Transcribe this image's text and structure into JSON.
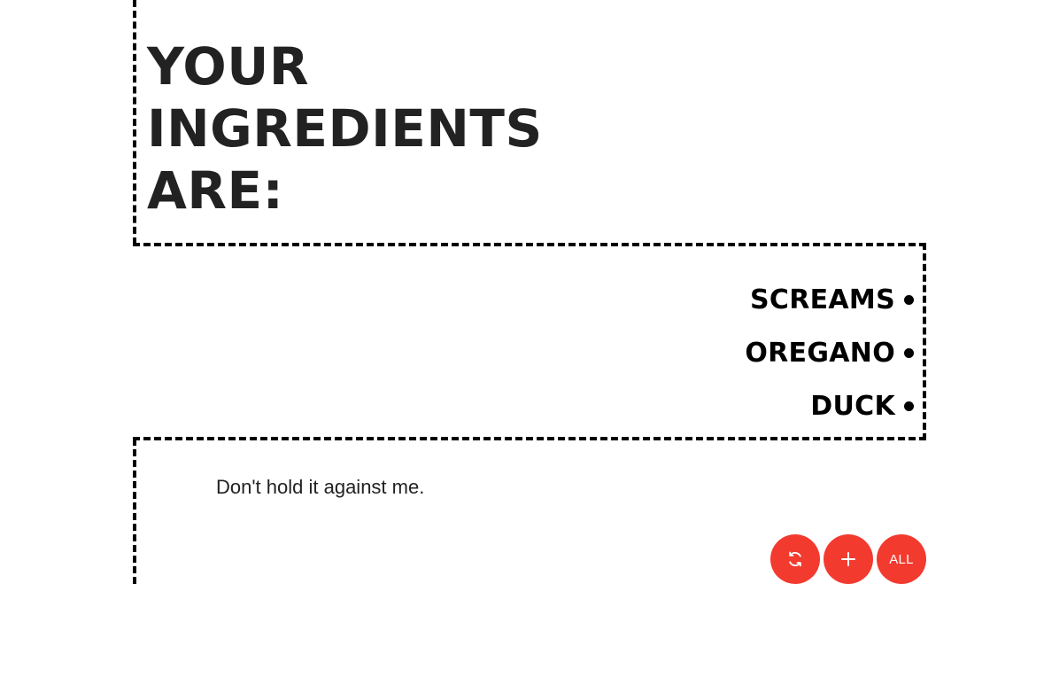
{
  "heading": {
    "line1": "YOUR",
    "line2": "INGREDIENTS",
    "line3": "ARE:"
  },
  "ingredients": [
    {
      "label": "SCREAMS"
    },
    {
      "label": "OREGANO"
    },
    {
      "label": "DUCK"
    }
  ],
  "quote": "Don't hold it against me.",
  "actions": {
    "refresh_icon": "refresh-icon",
    "add_icon": "plus-icon",
    "all_label": "ALL"
  },
  "colors": {
    "accent": "#f33a2f",
    "text": "#222222",
    "border": "#000000"
  }
}
